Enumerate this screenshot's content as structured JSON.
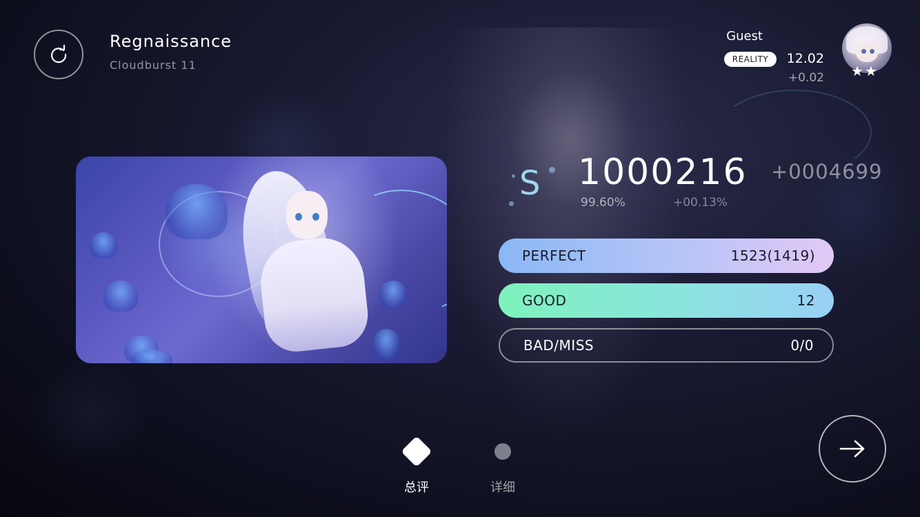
{
  "song": {
    "title": "Regnaissance",
    "difficulty": "Cloudburst 11"
  },
  "player": {
    "name": "Guest",
    "badge_label": "REALITY",
    "reality_value": "12.02",
    "reality_delta": "+0.02",
    "stars": "★★"
  },
  "result": {
    "rank": "S",
    "score": "1000216",
    "score_delta": "+0004699",
    "accuracy": "99.60%",
    "accuracy_delta": "+00.13%"
  },
  "judgments": [
    {
      "label": "PERFECT",
      "value": "1523(1419)"
    },
    {
      "label": "GOOD",
      "value": "12"
    },
    {
      "label": "BAD/MISS",
      "value": "0/0"
    }
  ],
  "nav": {
    "summary_label": "总评",
    "detail_label": "详细"
  },
  "icons": {
    "retry": "retry-icon",
    "next": "arrow-right-icon",
    "summary": "diamond-icon",
    "detail": "dot-icon"
  },
  "colors": {
    "perfect_start": "#8ab8f6",
    "perfect_end": "#e2c8f6",
    "good_start": "#7ef2bb",
    "good_end": "#9ad0f6",
    "rank": "#9fd6ee"
  }
}
